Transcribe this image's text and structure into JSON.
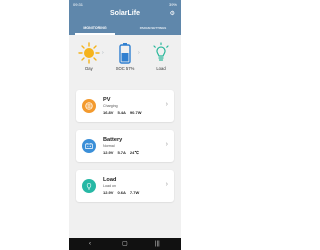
{
  "status_bar": {
    "time": "09:31",
    "battery": "39%"
  },
  "app": {
    "title": "SolarLife",
    "settings_icon": "gear-icon"
  },
  "tabs": [
    {
      "label": "MONITORING",
      "active": true
    },
    {
      "label": "PARAM SETTINGS",
      "active": false
    }
  ],
  "overview": {
    "day": "Day",
    "soc": "SOC 57%",
    "load": "Load"
  },
  "cards": {
    "pv": {
      "name": "PV",
      "status": "Charging",
      "voltage": "16.8V",
      "current": "5.4A",
      "power": "90.7W",
      "icon": "solar-panel-icon",
      "color": "#f39a2e"
    },
    "battery": {
      "name": "Battery",
      "status": "Normal",
      "voltage": "12.9V",
      "current": "5.7A",
      "temp": "24℃",
      "icon": "battery-icon",
      "color": "#3b8fd8"
    },
    "load": {
      "name": "Load",
      "status": "Load on",
      "voltage": "12.9V",
      "current": "0.6A",
      "power": "7.7W",
      "icon": "bulb-icon",
      "color": "#27b8a5"
    }
  },
  "nav": {
    "back": "‹",
    "home": "▢",
    "recent": "|||"
  },
  "colors": {
    "header": "#5f87ab",
    "sun": "#f5b31b",
    "battery_fill": "#2f7fd0",
    "bulb": "#29b89b"
  }
}
